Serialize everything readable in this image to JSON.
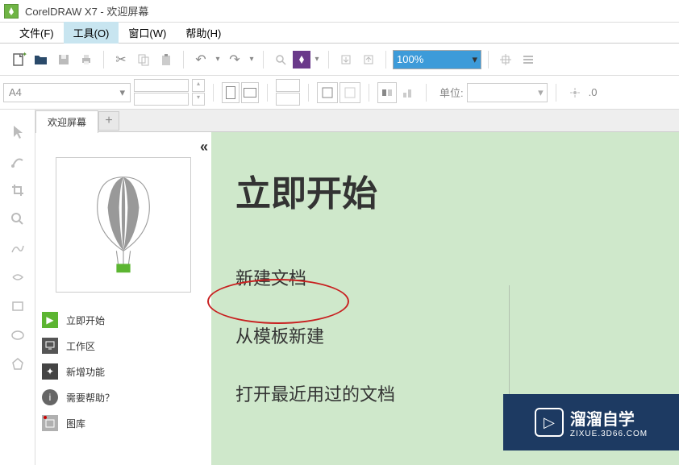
{
  "window": {
    "title": "CorelDRAW X7 - 欢迎屏幕"
  },
  "menu": {
    "file": "文件(F)",
    "tools": "工具(O)",
    "window": "窗口(W)",
    "help": "帮助(H)"
  },
  "toolbar": {
    "zoom_value": "100%"
  },
  "propbar": {
    "papersize": "A4",
    "unit_label": "单位:",
    "nudge_value": ".0"
  },
  "tabs": {
    "welcome": "欢迎屏幕"
  },
  "sidebar": {
    "items": [
      {
        "label": "立即开始"
      },
      {
        "label": "工作区"
      },
      {
        "label": "新增功能"
      },
      {
        "label": "需要帮助？"
      },
      {
        "label": "图库"
      }
    ]
  },
  "welcome": {
    "title": "立即开始",
    "link_new": "新建文档",
    "link_template": "从模板新建",
    "link_recent": "打开最近用过的文档"
  },
  "watermark": {
    "main": "溜溜自学",
    "sub": "ZIXUE.3D66.COM"
  }
}
